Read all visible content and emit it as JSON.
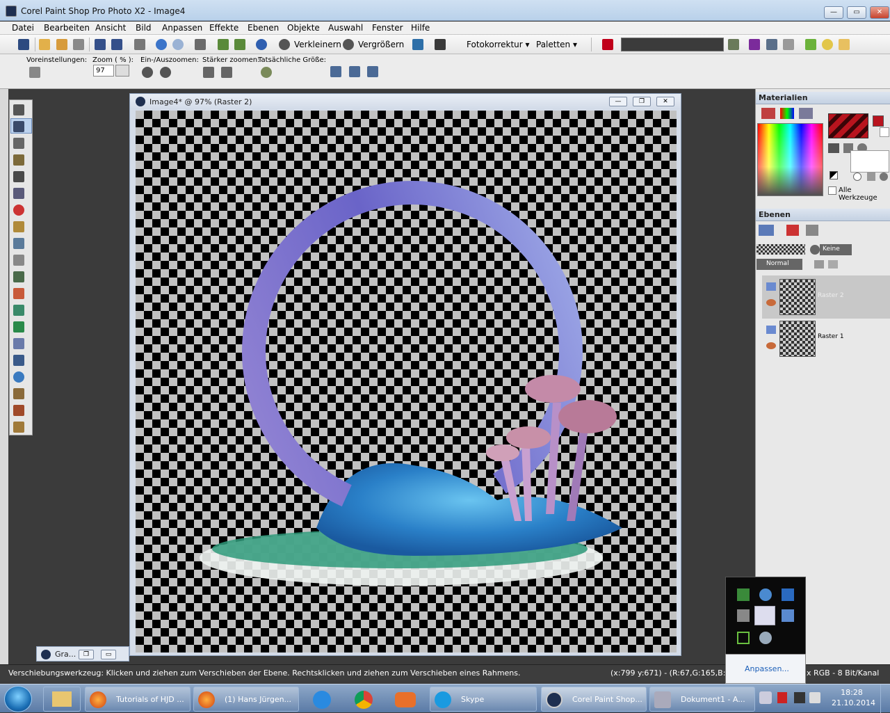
{
  "window": {
    "title": "Corel Paint Shop Pro Photo X2 - Image4"
  },
  "menu": [
    "Datei",
    "Bearbeiten",
    "Ansicht",
    "Bild",
    "Anpassen",
    "Effekte",
    "Ebenen",
    "Objekte",
    "Auswahl",
    "Fenster",
    "Hilfe"
  ],
  "toolbar": {
    "shrink_label": "Verkleinern",
    "enlarge_label": "Vergrößern",
    "photofix_label": "Fotokorrektur",
    "palettes_label": "Paletten"
  },
  "tool_options": {
    "presets_label": "Voreinstellungen:",
    "zoom_label": "Zoom ( % ):",
    "zoom_value": "97",
    "zoom_in_out_label": "Ein-/Auszoomen:",
    "zoom_more_label": "Stärker zoomen:",
    "actual_size_label": "Tatsächliche Größe:"
  },
  "image_window": {
    "title": "Image4* @ 97% (Raster 2)"
  },
  "minimized_window": {
    "label": "Gra..."
  },
  "materials": {
    "title": "Materialien",
    "all_tools_label": "Alle Werkzeuge",
    "fg_color": "#b8141e",
    "bg_color": "#ffffff"
  },
  "layers": {
    "title": "Ebenen",
    "blend_mode": "Normal",
    "mask_label": "Keine",
    "items": [
      {
        "name": "Raster 2"
      },
      {
        "name": "Raster 1"
      }
    ]
  },
  "status": {
    "message": "Verschiebungswerkzeug: Klicken und ziehen zum Verschieben der Ebene. Rechtsklicken und ziehen zum Verschieben eines Rahmens.",
    "coords": "(x:799 y:671) - (R:67,G:165,B:132",
    "mode": "x RGB - 8 Bit/Kanal"
  },
  "tray_popup": {
    "customize_label": "Anpassen..."
  },
  "taskbar": {
    "tasks": [
      {
        "label": "Tutorials of HJD ..."
      },
      {
        "label": "(1) Hans Jürgen..."
      },
      {
        "label": "Skype"
      },
      {
        "label": "Corel Paint Shop..."
      },
      {
        "label": "Dokument1 - A..."
      }
    ],
    "time": "18:28",
    "date": "21.10.2014"
  }
}
